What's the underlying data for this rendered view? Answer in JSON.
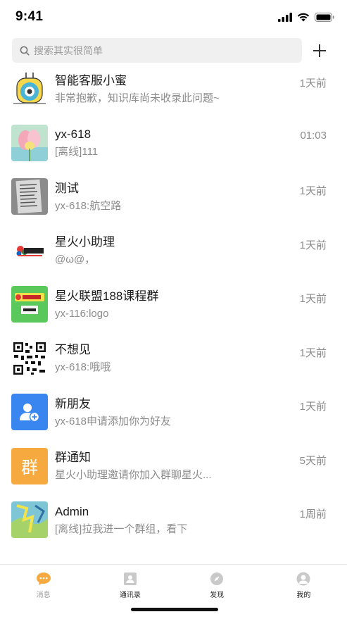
{
  "status_bar": {
    "time": "9:41"
  },
  "search": {
    "placeholder": "搜索其实很简单"
  },
  "conversations": [
    {
      "name": "智能客服小蜜",
      "message": "非常抱歉，知识库尚未收录此问题~",
      "time": "1天前"
    },
    {
      "name": "yx-618",
      "message": "[离线]111",
      "time": "01:03"
    },
    {
      "name": "测试",
      "message": "yx-618:航空路",
      "time": "1天前"
    },
    {
      "name": "星火小助理",
      "message": "@ω@，",
      "time": "1天前"
    },
    {
      "name": "星火联盟188课程群",
      "message": "yx-116:logo",
      "time": "1天前"
    },
    {
      "name": "不想见",
      "message": "yx-618:哦哦",
      "time": "1天前"
    },
    {
      "name": "新朋友",
      "message": "yx-618申请添加你为好友",
      "time": "1天前"
    },
    {
      "name": "群通知",
      "message": "星火小助理邀请你加入群聊星火...",
      "time": "5天前",
      "avatar_text": "群"
    },
    {
      "name": "Admin",
      "message": "[离线]拉我进一个群组，看下",
      "time": "1周前"
    }
  ],
  "tabbar": {
    "messages": "消息",
    "contacts": "通讯录",
    "discover": "发现",
    "me": "我的"
  },
  "colors": {
    "orange": "#f5a93f",
    "blue": "#3a86f0",
    "green": "#5ac85a"
  }
}
